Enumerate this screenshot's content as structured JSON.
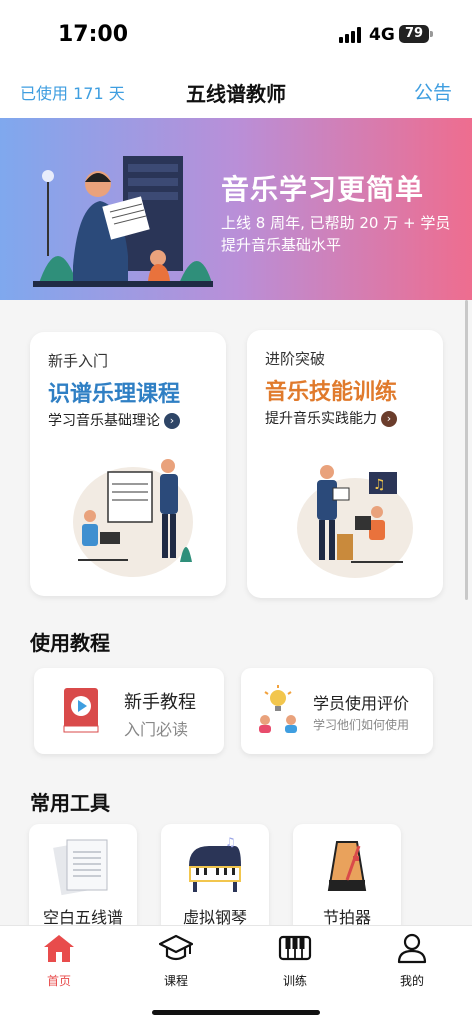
{
  "status": {
    "time": "17:00",
    "network": "4G",
    "battery": "79"
  },
  "header": {
    "days_used": "已使用 171 天",
    "title": "五线谱教师",
    "notice": "公告"
  },
  "banner": {
    "title": "音乐学习更简单",
    "subtitle": "上线 8 周年, 已帮助 20 万 + 学员提升音乐基础水平"
  },
  "courses": [
    {
      "kicker": "新手入门",
      "title": "识谱乐理课程",
      "sub": "学习音乐基础理论",
      "arrow": "›"
    },
    {
      "kicker": "进阶突破",
      "title": "音乐技能训练",
      "sub": "提升音乐实践能力",
      "arrow": "›"
    }
  ],
  "tutorial_section": {
    "title": "使用教程"
  },
  "tutorials": [
    {
      "title": "新手教程",
      "sub": "入门必读",
      "icon": "video-book-icon"
    },
    {
      "title": "学员使用评价",
      "sub": "学习他们如何使用",
      "icon": "lightbulb-users-icon"
    }
  ],
  "tools_section": {
    "title": "常用工具"
  },
  "tools": [
    {
      "label": "空白五线谱",
      "icon": "sheet-paper-icon"
    },
    {
      "label": "虚拟钢琴",
      "icon": "piano-icon"
    },
    {
      "label": "节拍器",
      "icon": "metronome-icon"
    }
  ],
  "tabs": [
    {
      "label": "首页",
      "icon": "home-icon",
      "active": true
    },
    {
      "label": "课程",
      "icon": "graduation-cap-icon",
      "active": false
    },
    {
      "label": "训练",
      "icon": "piano-keys-icon",
      "active": false
    },
    {
      "label": "我的",
      "icon": "user-icon",
      "active": false
    }
  ],
  "colors": {
    "accent_blue": "#3f9ee0",
    "course_blue": "#2f7fc4",
    "course_orange": "#e07a2c",
    "tab_active": "#e84c4c"
  }
}
